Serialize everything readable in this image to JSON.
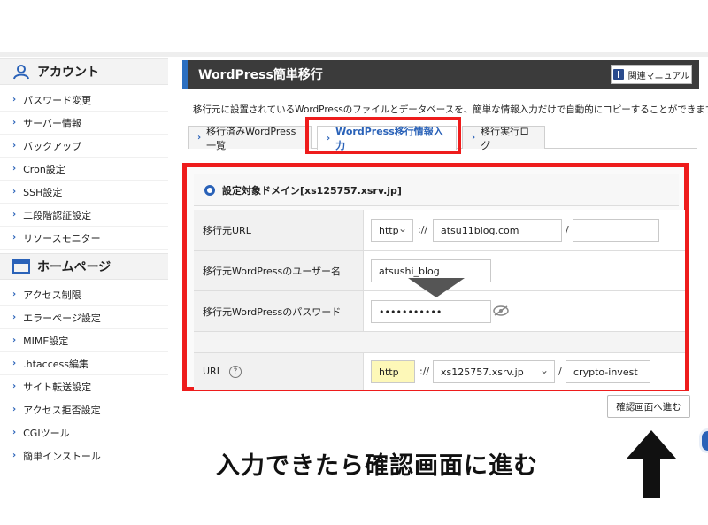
{
  "sidebar": {
    "account_title": "アカウント",
    "account_items": [
      "パスワード変更",
      "サーバー情報",
      "バックアップ",
      "Cron設定",
      "SSH設定",
      "二段階認証設定",
      "リソースモニター"
    ],
    "homepage_title": "ホームページ",
    "homepage_items": [
      "アクセス制限",
      "エラーページ設定",
      "MIME設定",
      ".htaccess編集",
      "サイト転送設定",
      "アクセス拒否設定",
      "CGIツール",
      "簡単インストール"
    ]
  },
  "header": {
    "title": "WordPress簡単移行",
    "manual_label": "関連マニュアル"
  },
  "description": "移行元に設置されているWordPressのファイルとデータベースを、簡単な情報入力だけで自動的にコピーすることができます",
  "tabs": [
    {
      "label": "移行済みWordPress一覧"
    },
    {
      "label": "WordPress移行情報入力"
    },
    {
      "label": "移行実行ログ"
    }
  ],
  "form": {
    "domain_label": "設定対象ドメイン[xs125757.xsrv.jp]",
    "source_url_label": "移行元URL",
    "source_scheme": "http",
    "scheme_sep": "://",
    "source_host": "atsu11blog.com",
    "path_sep": "/",
    "source_path": "",
    "username_label": "移行元WordPressのユーザー名",
    "username_value": "atsushi_blog",
    "password_label": "移行元WordPressのパスワード",
    "password_value": "•••••••••••",
    "url_label": "URL",
    "help_mark": "?",
    "dest_scheme": "http",
    "dest_domain": "xs125757.xsrv.jp",
    "dest_path": "crypto-invest"
  },
  "confirm_label": "確認画面へ進む",
  "caption": "入力できたら確認画面に進む",
  "colors": {
    "highlight": "#ee1c1c",
    "accent": "#2a62b8",
    "header_bg": "#3b3b3b",
    "scheme_highlight": "#fdf8b8"
  }
}
